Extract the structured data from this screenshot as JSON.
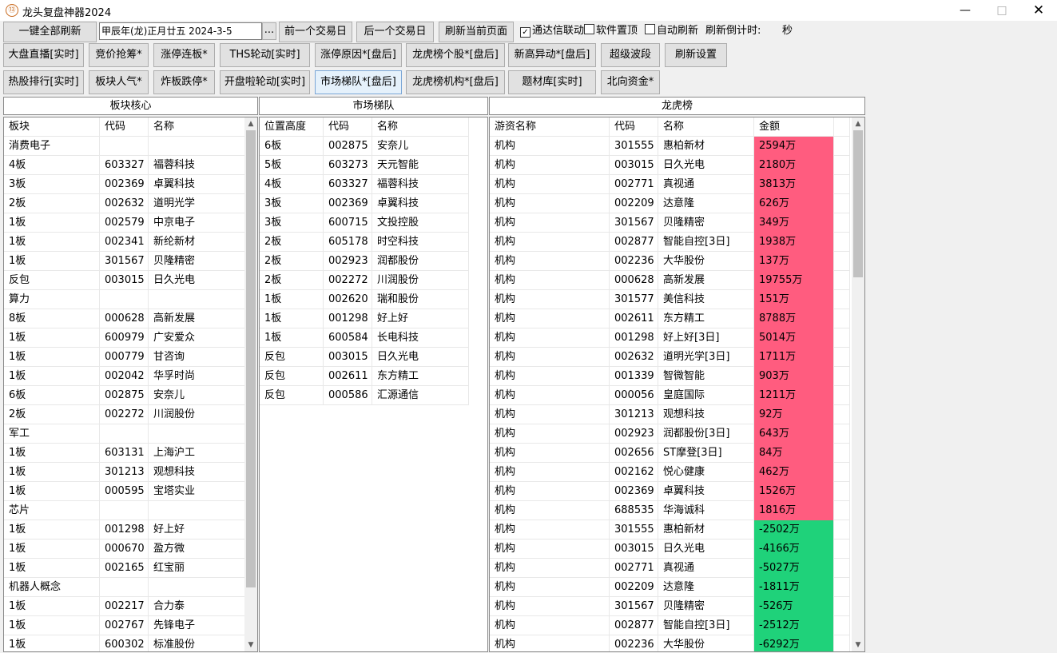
{
  "window": {
    "title": "龙头复盘神器2024",
    "icon_label": "⑬"
  },
  "toolbar": {
    "refresh_all": "一键全部刷新",
    "date_field": "甲辰年(龙)正月廿五  2024-3-5",
    "date_picker": "...",
    "prev_day": "前一个交易日",
    "next_day": "后一个交易日",
    "refresh_page": "刷新当前页面",
    "tdx_link": {
      "label": "通达信联动",
      "checked": true
    },
    "pin_top": {
      "label": "软件置顶",
      "checked": false
    },
    "auto_refresh": {
      "label": "自动刷新",
      "checked": false
    },
    "countdown_label": "刷新倒计时:",
    "countdown_unit": "秒"
  },
  "nav_row1": [
    "大盘直播[实时]",
    "竞价抢筹*",
    "涨停连板*",
    "THS轮动[实时]",
    "涨停原因*[盘后]",
    "龙虎榜个股*[盘后]",
    "新高异动*[盘后]",
    "超级波段",
    "刷新设置"
  ],
  "nav_row2": [
    "热股排行[实时]",
    "板块人气*",
    "炸板跌停*",
    "开盘啦轮动[实时]",
    "市场梯队*[盘后]",
    "龙虎榜机构*[盘后]",
    "题材库[实时]",
    "北向资金*"
  ],
  "panels": {
    "sector": {
      "title": "板块核心",
      "headers": [
        "板块",
        "代码",
        "名称"
      ],
      "rows": [
        [
          "消费电子",
          "",
          ""
        ],
        [
          "4板",
          "603327",
          "福蓉科技"
        ],
        [
          "3板",
          "002369",
          "卓翼科技"
        ],
        [
          "2板",
          "002632",
          "道明光学"
        ],
        [
          "1板",
          "002579",
          "中京电子"
        ],
        [
          "1板",
          "002341",
          "新纶新材"
        ],
        [
          "1板",
          "301567",
          "贝隆精密"
        ],
        [
          "反包",
          "003015",
          "日久光电"
        ],
        [
          "算力",
          "",
          ""
        ],
        [
          "8板",
          "000628",
          "高新发展"
        ],
        [
          "1板",
          "600979",
          "广安爱众"
        ],
        [
          "1板",
          "000779",
          "甘咨询"
        ],
        [
          "1板",
          "002042",
          "华孚时尚"
        ],
        [
          "6板",
          "002875",
          "安奈儿"
        ],
        [
          "2板",
          "002272",
          "川润股份"
        ],
        [
          "军工",
          "",
          ""
        ],
        [
          "1板",
          "603131",
          "上海沪工"
        ],
        [
          "1板",
          "301213",
          "观想科技"
        ],
        [
          "1板",
          "000595",
          "宝塔实业"
        ],
        [
          "芯片",
          "",
          ""
        ],
        [
          "1板",
          "001298",
          "好上好"
        ],
        [
          "1板",
          "000670",
          "盈方微"
        ],
        [
          "1板",
          "002165",
          "红宝丽"
        ],
        [
          "机器人概念",
          "",
          ""
        ],
        [
          "1板",
          "002217",
          "合力泰"
        ],
        [
          "1板",
          "002767",
          "先锋电子"
        ],
        [
          "1板",
          "600302",
          "标准股份"
        ]
      ]
    },
    "ladder": {
      "title": "市场梯队",
      "headers": [
        "位置高度",
        "代码",
        "名称"
      ],
      "rows": [
        [
          "6板",
          "002875",
          "安奈儿"
        ],
        [
          "5板",
          "603273",
          "天元智能"
        ],
        [
          "4板",
          "603327",
          "福蓉科技"
        ],
        [
          "3板",
          "002369",
          "卓翼科技"
        ],
        [
          "3板",
          "600715",
          "文投控股"
        ],
        [
          "2板",
          "605178",
          "时空科技"
        ],
        [
          "2板",
          "002923",
          "润都股份"
        ],
        [
          "2板",
          "002272",
          "川润股份"
        ],
        [
          "1板",
          "002620",
          "瑞和股份"
        ],
        [
          "1板",
          "001298",
          "好上好"
        ],
        [
          "1板",
          "600584",
          "长电科技"
        ],
        [
          "反包",
          "003015",
          "日久光电"
        ],
        [
          "反包",
          "002611",
          "东方精工"
        ],
        [
          "反包",
          "000586",
          "汇源通信"
        ]
      ]
    },
    "lhb": {
      "title": "龙虎榜",
      "headers": [
        "游资名称",
        "代码",
        "名称",
        "金额"
      ],
      "rows": [
        [
          "机构",
          "301555",
          "惠柏新材",
          "2594万"
        ],
        [
          "机构",
          "003015",
          "日久光电",
          "2180万"
        ],
        [
          "机构",
          "002771",
          "真视通",
          "3813万"
        ],
        [
          "机构",
          "002209",
          "达意隆",
          "626万"
        ],
        [
          "机构",
          "301567",
          "贝隆精密",
          "349万"
        ],
        [
          "机构",
          "002877",
          "智能自控[3日]",
          "1938万"
        ],
        [
          "机构",
          "002236",
          "大华股份",
          "137万"
        ],
        [
          "机构",
          "000628",
          "高新发展",
          "19755万"
        ],
        [
          "机构",
          "301577",
          "美信科技",
          "151万"
        ],
        [
          "机构",
          "002611",
          "东方精工",
          "8788万"
        ],
        [
          "机构",
          "001298",
          "好上好[3日]",
          "5014万"
        ],
        [
          "机构",
          "002632",
          "道明光学[3日]",
          "1711万"
        ],
        [
          "机构",
          "001339",
          "智微智能",
          "903万"
        ],
        [
          "机构",
          "000056",
          "皇庭国际",
          "1211万"
        ],
        [
          "机构",
          "301213",
          "观想科技",
          "92万"
        ],
        [
          "机构",
          "002923",
          "润都股份[3日]",
          "643万"
        ],
        [
          "机构",
          "002656",
          "ST摩登[3日]",
          "84万"
        ],
        [
          "机构",
          "002162",
          "悦心健康",
          "462万"
        ],
        [
          "机构",
          "002369",
          "卓翼科技",
          "1526万"
        ],
        [
          "机构",
          "688535",
          "华海诚科",
          "1816万"
        ],
        [
          "机构",
          "301555",
          "惠柏新材",
          "-2502万"
        ],
        [
          "机构",
          "003015",
          "日久光电",
          "-4166万"
        ],
        [
          "机构",
          "002771",
          "真视通",
          "-5027万"
        ],
        [
          "机构",
          "002209",
          "达意隆",
          "-1811万"
        ],
        [
          "机构",
          "301567",
          "贝隆精密",
          "-526万"
        ],
        [
          "机构",
          "002877",
          "智能自控[3日]",
          "-2512万"
        ],
        [
          "机构",
          "002236",
          "大华股份",
          "-6292万"
        ]
      ],
      "colors": {
        "positive": "#ff5c7f",
        "negative": "#1fd27a"
      }
    }
  },
  "scrollbars": {
    "sector": {
      "thumb_start": 0.0,
      "thumb_end": 0.9
    },
    "lhb": {
      "thumb_start": 0.0,
      "thumb_end": 0.29
    }
  }
}
